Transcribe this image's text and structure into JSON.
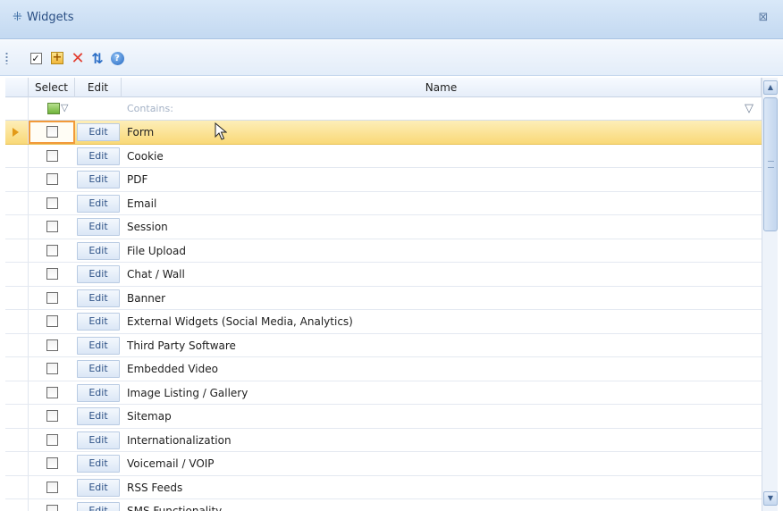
{
  "window": {
    "title": "Widgets",
    "title_icon": "widgets-icon",
    "close_icon": "close-icon",
    "close_glyph": "⊠"
  },
  "toolbar": {
    "buttons": [
      {
        "name": "select-all-button",
        "icon": "checkbox-icon"
      },
      {
        "name": "add-button",
        "icon": "add-icon"
      },
      {
        "name": "delete-button",
        "icon": "delete-icon"
      },
      {
        "name": "refresh-button",
        "icon": "refresh-icon"
      },
      {
        "name": "help-button",
        "icon": "help-icon"
      }
    ]
  },
  "grid": {
    "columns": [
      "Select",
      "Edit",
      "Name"
    ],
    "filter": {
      "name_placeholder": "Contains:"
    },
    "edit_label": "Edit",
    "current_row_index": 0,
    "rows": [
      {
        "name": "Form",
        "selected": false
      },
      {
        "name": "Cookie",
        "selected": false
      },
      {
        "name": "PDF",
        "selected": false
      },
      {
        "name": "Email",
        "selected": false
      },
      {
        "name": "Session",
        "selected": false
      },
      {
        "name": "File Upload",
        "selected": false
      },
      {
        "name": "Chat / Wall",
        "selected": false
      },
      {
        "name": "Banner",
        "selected": false
      },
      {
        "name": "External Widgets (Social Media, Analytics)",
        "selected": false
      },
      {
        "name": "Third Party Software",
        "selected": false
      },
      {
        "name": "Embedded Video",
        "selected": false
      },
      {
        "name": "Image Listing / Gallery",
        "selected": false
      },
      {
        "name": "Sitemap",
        "selected": false
      },
      {
        "name": "Internationalization",
        "selected": false
      },
      {
        "name": "Voicemail / VOIP",
        "selected": false
      },
      {
        "name": "RSS Feeds",
        "selected": false
      },
      {
        "name": "SMS Functionality",
        "selected": false
      }
    ]
  },
  "colors": {
    "title_bar": "#c3d9f1",
    "current_row": "#f9d978",
    "current_cell_border": "#f29a3a",
    "title_text": "#2a4f84"
  }
}
